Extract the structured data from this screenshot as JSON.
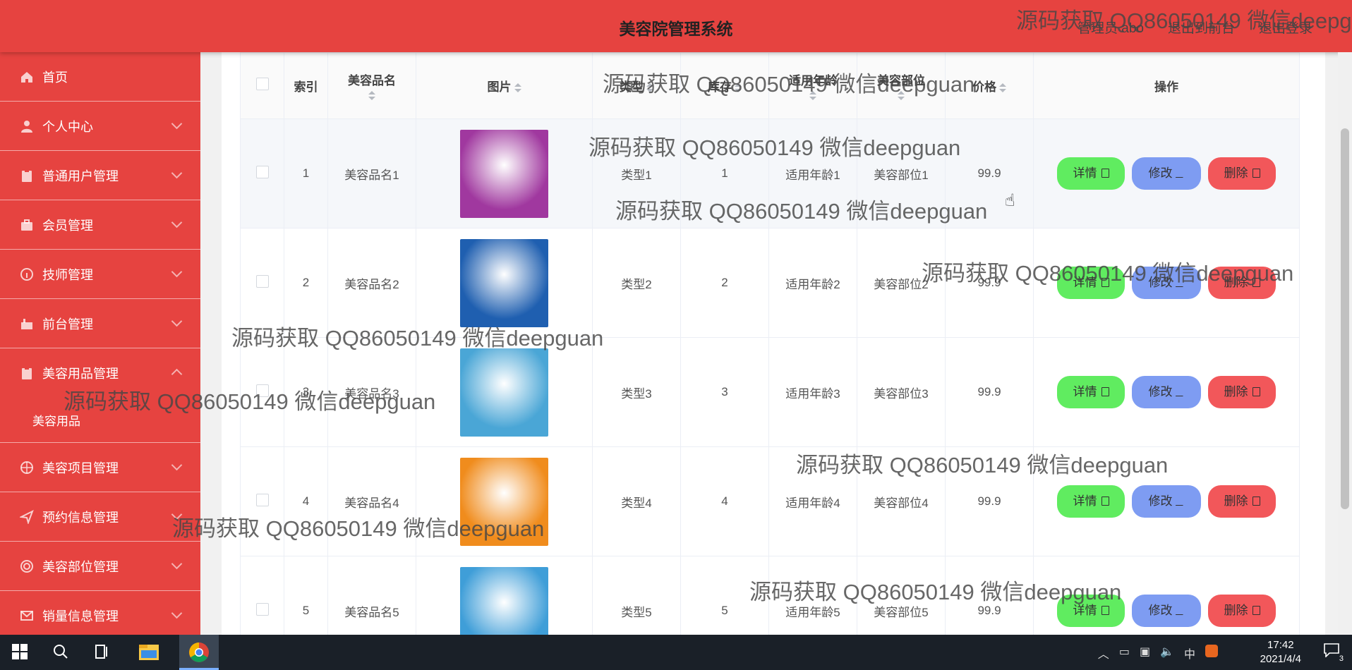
{
  "header": {
    "title": "美容院管理系统",
    "links": [
      "管理员 abo",
      "退出到前台",
      "退出登录"
    ]
  },
  "sidebar": {
    "items": [
      {
        "label": "首页",
        "icon": "home-icon"
      },
      {
        "label": "个人中心",
        "icon": "user-icon"
      },
      {
        "label": "普通用户管理",
        "icon": "clipboard-icon"
      },
      {
        "label": "会员管理",
        "icon": "briefcase-icon"
      },
      {
        "label": "技师管理",
        "icon": "info-icon"
      },
      {
        "label": "前台管理",
        "icon": "desk-icon"
      },
      {
        "label": "美容用品管理",
        "icon": "clipboard-icon",
        "sub": "美容用品"
      },
      {
        "label": "美容项目管理",
        "icon": "globe-icon"
      },
      {
        "label": "预约信息管理",
        "icon": "send-icon"
      },
      {
        "label": "美容部位管理",
        "icon": "target-icon"
      },
      {
        "label": "销量信息管理",
        "icon": "mail-icon"
      }
    ]
  },
  "table": {
    "headers": {
      "index": "索引",
      "name": "美容品名",
      "image": "图片",
      "type": "类型",
      "stock": "库存",
      "age": "适用年龄",
      "part": "美容部位",
      "price": "价格",
      "ops": "操作"
    },
    "buttons": {
      "detail": "详情",
      "edit": "修改",
      "delete": "删除"
    },
    "rows": [
      {
        "index": "1",
        "name": "美容品名1",
        "type": "类型1",
        "stock": "1",
        "age": "适用年龄1",
        "part": "美容部位1",
        "price": "99.9",
        "image_color": "#a0389f"
      },
      {
        "index": "2",
        "name": "美容品名2",
        "type": "类型2",
        "stock": "2",
        "age": "适用年龄2",
        "part": "美容部位2",
        "price": "99.9",
        "image_color": "#1f5fb0"
      },
      {
        "index": "3",
        "name": "美容品名3",
        "type": "类型3",
        "stock": "3",
        "age": "适用年龄3",
        "part": "美容部位3",
        "price": "99.9",
        "image_color": "#4aa6d6"
      },
      {
        "index": "4",
        "name": "美容品名4",
        "type": "类型4",
        "stock": "4",
        "age": "适用年龄4",
        "part": "美容部位4",
        "price": "99.9",
        "image_color": "#f08c1d"
      },
      {
        "index": "5",
        "name": "美容品名5",
        "type": "类型5",
        "stock": "5",
        "age": "适用年龄5",
        "part": "美容部位5",
        "price": "99.9",
        "image_color": "#3f9ed8"
      }
    ]
  },
  "watermark": "源码获取 QQ86050149 微信deepguan",
  "taskbar": {
    "time": "17:42",
    "date": "2021/4/4",
    "ime": "中",
    "notification_count": "3"
  },
  "colors": {
    "primary_red": "#e64340",
    "detail_green": "#60ec60",
    "edit_blue": "#7e9cf2",
    "delete_red": "#f2575a"
  }
}
